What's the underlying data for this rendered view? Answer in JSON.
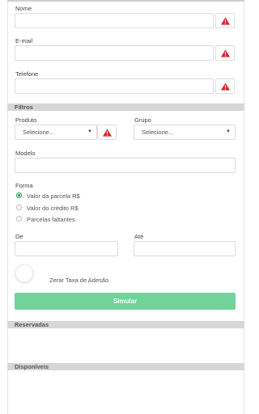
{
  "fields": {
    "nome_label": "Nome",
    "email_label": "E-mail",
    "telefone_label": "Telefone"
  },
  "filtros": {
    "title": "Filtros",
    "produto_label": "Produto",
    "produto_value": "Selecione...",
    "grupo_label": "Grupo",
    "grupo_value": "Selecione...",
    "modelo_label": "Modelo"
  },
  "forma": {
    "label": "Forma",
    "options": [
      "Valor da parcela R$",
      "Valor do crédito R$",
      "Parcelas faltantes"
    ],
    "selected_index": 0
  },
  "range": {
    "de_label": "De",
    "ate_label": "Até"
  },
  "toggle": {
    "label": "Zerar Taxa de Adesão"
  },
  "actions": {
    "simular_label": "Simular"
  },
  "sections": {
    "reservadas": "Reservadas",
    "disponiveis": "Disponíveis"
  },
  "colors": {
    "accent": "#6fd39a",
    "warning": "#d9232d",
    "section_bg": "#d6d6d6"
  }
}
